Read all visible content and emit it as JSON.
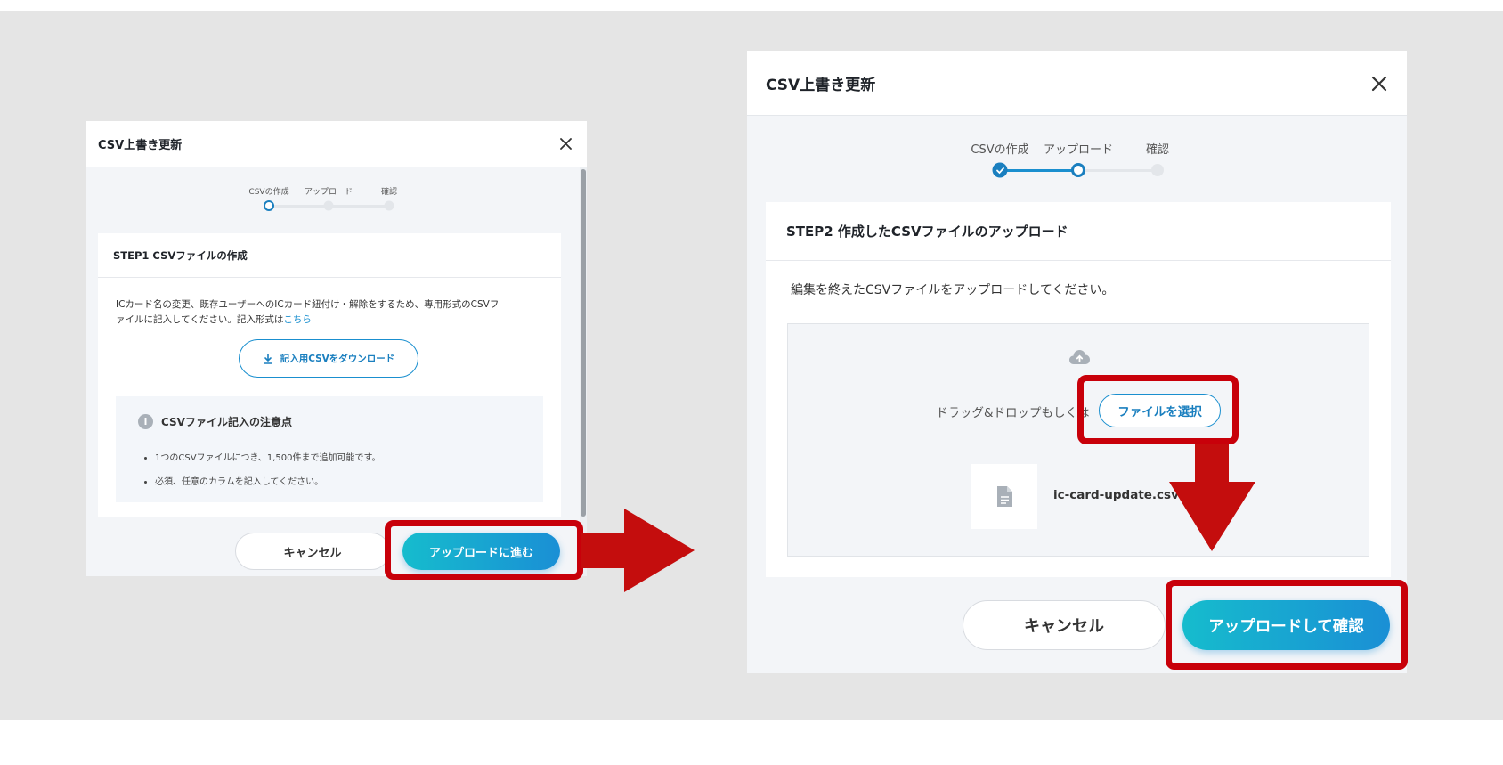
{
  "colors": {
    "accent": "#1a8fcf",
    "highlight": "#c8000a",
    "arrow": "#c40d0d"
  },
  "left_modal": {
    "title": "CSV上書き更新",
    "steps": [
      "CSVの作成",
      "アップロード",
      "確認"
    ],
    "card_title": "STEP1 CSVファイルの作成",
    "description_line1": "ICカード名の変更、既存ユーザーへのICカード紐付け・解除をするため、専用形式のCSVフ",
    "description_line2_prefix": "ァイルに記入してください。記入形式は",
    "description_link": "こちら",
    "download_icon": "download-icon",
    "download_label": "記入用CSVをダウンロード",
    "notice_icon": "info-icon",
    "notice_title": "CSVファイル記入の注意点",
    "notice_items": [
      "1つのCSVファイルにつき、1,500件まで追加可能です。",
      "必須、任意のカラムを記入してください。"
    ],
    "cancel_label": "キャンセル",
    "primary_label": "アップロードに進む"
  },
  "right_modal": {
    "title": "CSV上書き更新",
    "steps": [
      "CSVの作成",
      "アップロード",
      "確認"
    ],
    "card_title": "STEP2 作成したCSVファイルのアップロード",
    "description": "編集を終えたCSVファイルをアップロードしてください。",
    "upload_icon": "cloud-upload-icon",
    "drop_text": "ドラッグ&ドロップもしくは",
    "select_file_label": "ファイルを選択",
    "file_icon": "file-icon",
    "file_name": "ic-card-update.csv",
    "cancel_label": "キャンセル",
    "primary_label": "アップロードして確認"
  }
}
